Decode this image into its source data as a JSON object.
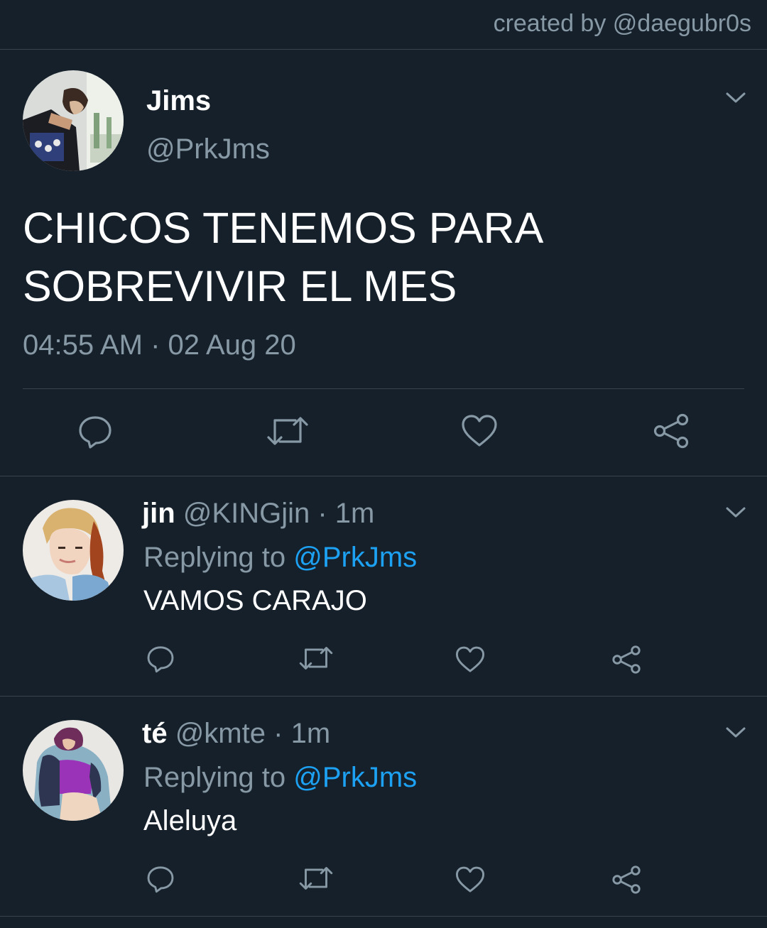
{
  "credit": "created by @daegubr0s",
  "colors": {
    "background": "#15202b",
    "divider": "#38444d",
    "secondary_text": "#8899a6",
    "link": "#1da1f2",
    "primary_text": "#ffffff"
  },
  "main_tweet": {
    "name": "Jims",
    "handle": "@PrkJms",
    "text": "CHICOS TENEMOS PARA SOBREVIVIR EL MES",
    "timestamp": "04:55 AM · 02 Aug 20",
    "avatar_icon": "user-avatar-jims",
    "menu_icon": "chevron-down-icon",
    "actions": [
      "reply-icon",
      "retweet-icon",
      "like-icon",
      "share-icon"
    ]
  },
  "replies": [
    {
      "name": "jin",
      "handle": "@KINGjin",
      "separator": "·",
      "time": "1m",
      "replying_prefix": "Replying to",
      "replying_to": "@PrkJms",
      "text": "VAMOS CARAJO",
      "avatar_icon": "user-avatar-jin"
    },
    {
      "name": "té",
      "handle": "@kmte",
      "separator": "·",
      "time": "1m",
      "replying_prefix": "Replying to",
      "replying_to": "@PrkJms",
      "text": "Aleluya",
      "avatar_icon": "user-avatar-te"
    }
  ]
}
